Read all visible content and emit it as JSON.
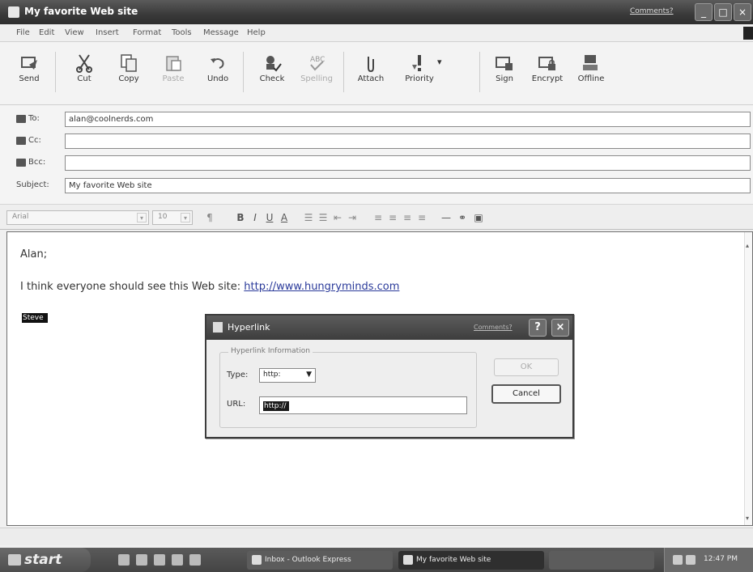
{
  "window": {
    "title": "My favorite Web site",
    "comments_link": "Comments?",
    "controls": {
      "minimize": "_",
      "maximize": "□",
      "close": "×"
    }
  },
  "menu": {
    "items": [
      "File",
      "Edit",
      "View",
      "Insert",
      "Format",
      "Tools",
      "Message",
      "Help"
    ]
  },
  "toolbar": {
    "buttons": [
      {
        "label": "Send",
        "icon": "send-icon",
        "enabled": true
      },
      {
        "label": "Cut",
        "icon": "scissors-icon",
        "enabled": true
      },
      {
        "label": "Copy",
        "icon": "copy-icon",
        "enabled": true
      },
      {
        "label": "Paste",
        "icon": "paste-icon",
        "enabled": false
      },
      {
        "label": "Undo",
        "icon": "undo-icon",
        "enabled": true
      },
      {
        "label": "Check",
        "icon": "check-names-icon",
        "enabled": true
      },
      {
        "label": "Spelling",
        "icon": "spelling-icon",
        "enabled": false
      },
      {
        "label": "Attach",
        "icon": "paperclip-icon",
        "enabled": true
      },
      {
        "label": "Priority",
        "icon": "priority-icon",
        "enabled": true
      },
      {
        "label": "Sign",
        "icon": "sign-icon",
        "enabled": true
      },
      {
        "label": "Encrypt",
        "icon": "encrypt-icon",
        "enabled": true
      },
      {
        "label": "Offline",
        "icon": "offline-icon",
        "enabled": true
      }
    ]
  },
  "header": {
    "to_label": "To:",
    "to_value": "alan@coolnerds.com",
    "cc_label": "Cc:",
    "cc_value": "",
    "bcc_label": "Bcc:",
    "bcc_value": "",
    "subject_label": "Subject:",
    "subject_value": "My favorite Web site"
  },
  "format": {
    "font": "Arial",
    "size": "10"
  },
  "message": {
    "greeting": "Alan;",
    "body_text": "I think everyone should see this Web site: ",
    "link": "http://www.hungryminds.com",
    "selected_word": "Steve"
  },
  "dialog": {
    "title": "Hyperlink",
    "comments_link": "Comments?",
    "group_label": "Hyperlink Information",
    "type_label": "Type:",
    "type_value": "http:",
    "url_label": "URL:",
    "url_value": "http://",
    "ok_label": "OK",
    "cancel_label": "Cancel",
    "help": "?",
    "close": "×"
  },
  "taskbar": {
    "start_label": "start",
    "tasks": [
      "Inbox - Outlook Express",
      "My favorite Web site",
      ""
    ],
    "clock": "12:47 PM"
  },
  "colors": {
    "titlebar": "#3a3a3a",
    "link": "#2a3a9a",
    "selection": "#111111"
  }
}
